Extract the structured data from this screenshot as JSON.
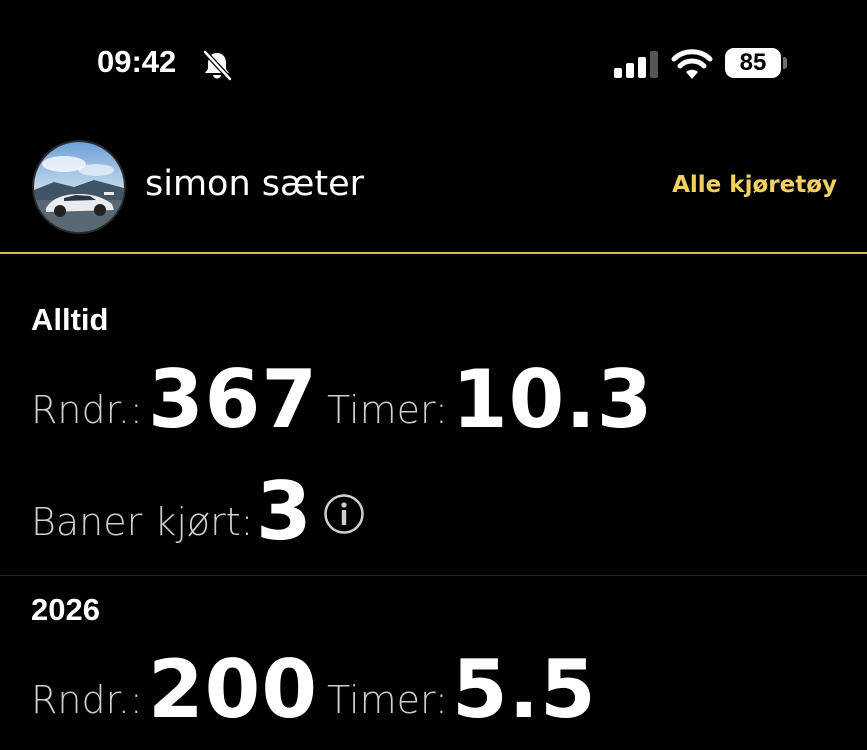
{
  "status_bar": {
    "time": "09:42",
    "battery_level": "85",
    "icons": [
      "bell-muted-icon",
      "cellular-signal-icon",
      "wifi-icon",
      "battery-icon"
    ]
  },
  "profile": {
    "name": "simon sæter",
    "all_vehicles_link": "Alle kjøretøy",
    "avatar": "car-photo-avatar"
  },
  "colors": {
    "background": "#000000",
    "accent": "#f2d061",
    "divider": "#d8b84a"
  },
  "sections": [
    {
      "title": "Alltid",
      "laps_label": "Rndr.:",
      "laps_value": "367",
      "hours_label": "Timer:",
      "hours_value": "10.3",
      "tracks_label": "Baner kjørt:",
      "tracks_value": "3"
    },
    {
      "title": "2026",
      "laps_label": "Rndr.:",
      "laps_value": "200",
      "hours_label": "Timer:",
      "hours_value": "5.5"
    }
  ]
}
